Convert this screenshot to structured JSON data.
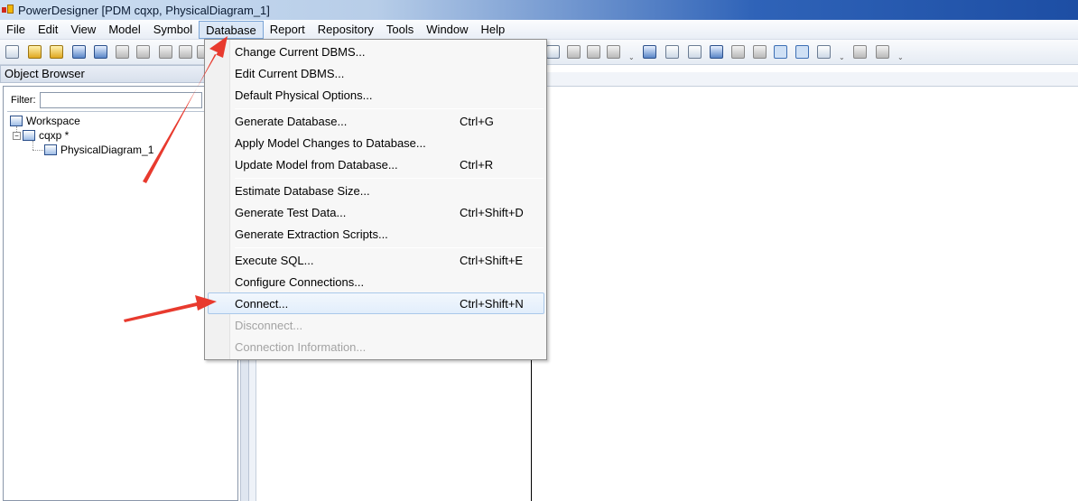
{
  "window": {
    "title": "PowerDesigner [PDM cqxp, PhysicalDiagram_1]"
  },
  "menubar": {
    "items": [
      {
        "label": "File"
      },
      {
        "label": "Edit"
      },
      {
        "label": "View"
      },
      {
        "label": "Model"
      },
      {
        "label": "Symbol"
      },
      {
        "label": "Database",
        "active": true
      },
      {
        "label": "Report"
      },
      {
        "label": "Repository"
      },
      {
        "label": "Tools"
      },
      {
        "label": "Window"
      },
      {
        "label": "Help"
      }
    ]
  },
  "object_browser": {
    "title": "Object Browser",
    "filter_label": "Filter:",
    "filter_value": "",
    "tree": {
      "workspace": "Workspace",
      "model": "cqxp *",
      "diagram": "PhysicalDiagram_1"
    }
  },
  "database_menu": {
    "items": [
      {
        "label": "Change Current DBMS...",
        "shortcut": ""
      },
      {
        "label": "Edit Current DBMS...",
        "shortcut": ""
      },
      {
        "label": "Default Physical Options...",
        "shortcut": ""
      },
      {
        "label": "Generate Database...",
        "shortcut": "Ctrl+G"
      },
      {
        "label": "Apply Model Changes to Database...",
        "shortcut": ""
      },
      {
        "label": "Update Model from Database...",
        "shortcut": "Ctrl+R"
      },
      {
        "label": "Estimate Database Size...",
        "shortcut": ""
      },
      {
        "label": "Generate Test Data...",
        "shortcut": "Ctrl+Shift+D"
      },
      {
        "label": "Generate Extraction Scripts...",
        "shortcut": ""
      },
      {
        "label": "Execute SQL...",
        "shortcut": "Ctrl+Shift+E"
      },
      {
        "label": "Configure Connections...",
        "shortcut": ""
      },
      {
        "label": "Connect...",
        "shortcut": "Ctrl+Shift+N",
        "highlighted": true
      },
      {
        "label": "Disconnect...",
        "shortcut": "",
        "disabled": true
      },
      {
        "label": "Connection Information...",
        "shortcut": "",
        "disabled": true
      }
    ]
  },
  "colors": {
    "annotation_arrow": "#e83a2e",
    "menu_highlight": "#e2eefb",
    "disabled_text": "#a3a3a3"
  }
}
